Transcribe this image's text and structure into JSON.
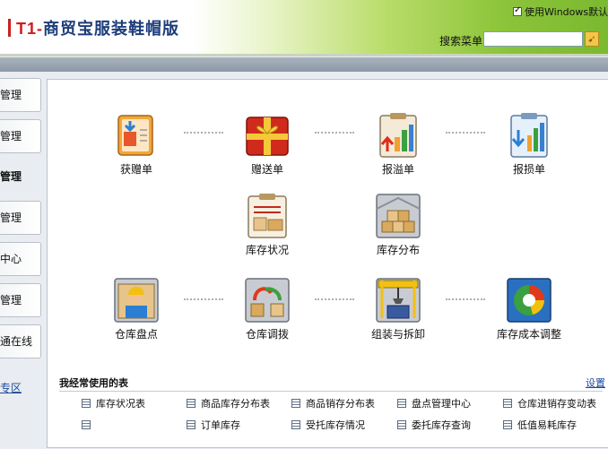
{
  "app": {
    "logo_prefix": "T1-",
    "logo_text": "商贸宝服装鞋帽版",
    "windows_style_label": "使用Windows默认风格",
    "search_label": "搜索菜单",
    "search_value": ""
  },
  "sidebar": {
    "items": [
      "管理",
      "管理",
      "管理",
      "管理",
      "中心",
      "管理",
      "通在线"
    ],
    "link": "专区"
  },
  "tiles": [
    {
      "label": "获赠单",
      "icon": "gift-received-icon"
    },
    {
      "label": "赠送单",
      "icon": "gift-box-icon"
    },
    {
      "label": "报溢单",
      "icon": "overflow-report-icon"
    },
    {
      "label": "报损单",
      "icon": "loss-report-icon"
    },
    {
      "label": "库存状况",
      "icon": "inventory-status-icon"
    },
    {
      "label": "库存分布",
      "icon": "inventory-distribution-icon"
    },
    {
      "label": "仓库盘点",
      "icon": "warehouse-count-icon"
    },
    {
      "label": "仓库调拨",
      "icon": "warehouse-transfer-icon"
    },
    {
      "label": "组装与拆卸",
      "icon": "assembly-crane-icon"
    },
    {
      "label": "库存成本调整",
      "icon": "cost-adjust-icon"
    }
  ],
  "frequent": {
    "title": "我经常使用的表",
    "settings_label": "设置",
    "rows": [
      [
        "库存状况表",
        "商品库存分布表",
        "商品销存分布表",
        "盘点管理中心",
        "仓库进销存变动表"
      ],
      [
        "",
        "订单库存",
        "受托库存情况",
        "委托库存查询",
        "低值易耗库存"
      ]
    ]
  },
  "colors": {
    "header_green": "#8cc43a",
    "logo_blue": "#1d3d7a",
    "logo_red": "#cc1f1f",
    "link_blue": "#1a4a9a"
  }
}
